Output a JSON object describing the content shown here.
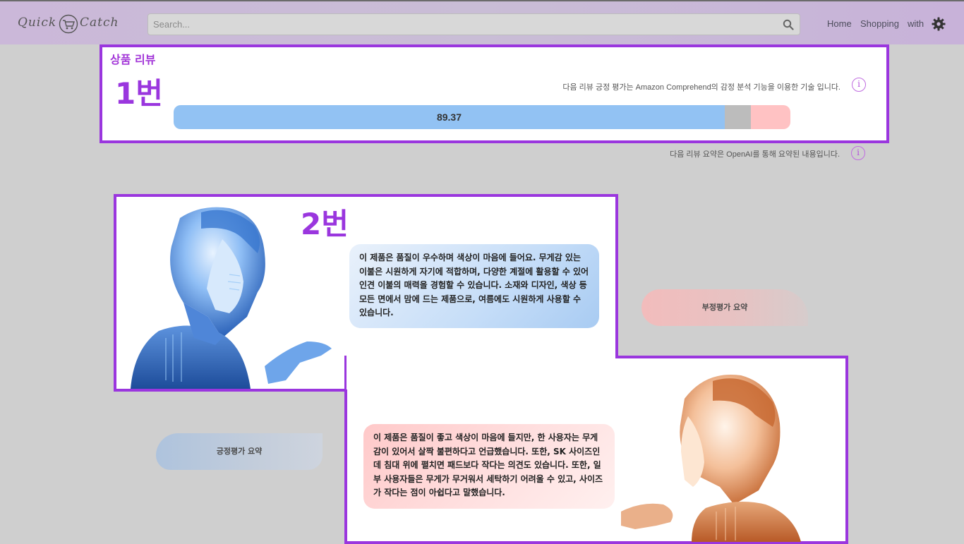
{
  "header": {
    "logo_left": "Quick",
    "logo_right": "Catch",
    "search_placeholder": "Search...",
    "nav": [
      "Home",
      "Shopping",
      "with"
    ]
  },
  "review": {
    "section_title": "상품 리뷰",
    "marker_1": "1번",
    "marker_2": "2번",
    "sentiment_info": "다음 리뷰 긍정 평가는 Amazon Comprehend의 감정 분석 기능을 이용한 기술 입니다.",
    "summary_info": "다음 리뷰 요약은 OpenAI를 통해 요약된 내용입니다.",
    "info_icon_glyph": "i",
    "positive_score": "89.37",
    "bar_fractions": {
      "positive": 0.8937,
      "neutral": 0.0423,
      "negative": 0.064
    },
    "colors": {
      "positive": "#92c2f3",
      "neutral": "#bcbcbc",
      "negative": "#ffc2c3",
      "accent": "#9a36de"
    }
  },
  "summaries": {
    "positive_label": "긍정평가 요약",
    "negative_label": "부정평가 요약",
    "positive_text": "이 제품은 품질이 우수하며 색상이 마음에 들어요. 무게감 있는 이불은 시원하게 자기에 적합하며, 다양한 계절에 활용할 수 있어 인견 이불의 매력을 경험할 수 있습니다. 소재와 디자인, 색상 등 모든 면에서 맘에 드는 제품으로, 여름에도 시원하게 사용할 수 있습니다.",
    "negative_text": "이 제품은 품질이 좋고 색상이 마음에 들지만, 한 사용자는 무게감이 있어서 살짝 불편하다고 언급했습니다. 또한, SK 사이즈인데 침대 위에 펼치면 패드보다 작다는 의견도 있습니다. 또한, 일부 사용자들은 무게가 무거워서 세탁하기 어려울 수 있고, 사이즈가 작다는 점이 아쉽다고 말했습니다."
  }
}
